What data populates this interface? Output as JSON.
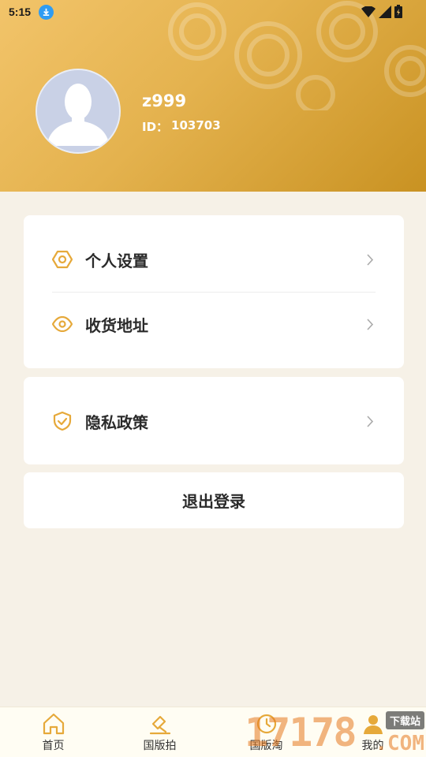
{
  "status_bar": {
    "time": "5:15"
  },
  "profile": {
    "username": "z999",
    "id_label": "ID：",
    "id_value": "103703"
  },
  "menu": {
    "personal_settings": "个人设置",
    "shipping_address": "收货地址",
    "privacy_policy": "隐私政策",
    "logout": "退出登录"
  },
  "bottom_nav": [
    {
      "label": "首页",
      "icon": "home-icon"
    },
    {
      "label": "国版拍",
      "icon": "auction-hammer-icon"
    },
    {
      "label": "国版淘",
      "icon": "shop-icon"
    },
    {
      "label": "我的",
      "icon": "profile-icon",
      "active": true
    }
  ],
  "watermark": {
    "number": "17178",
    "tag": "下载站",
    "suffix": ".COM"
  },
  "colors": {
    "accent": "#e4b24e",
    "icon_gold": "#e6a93a",
    "background": "#f6f1e7"
  }
}
